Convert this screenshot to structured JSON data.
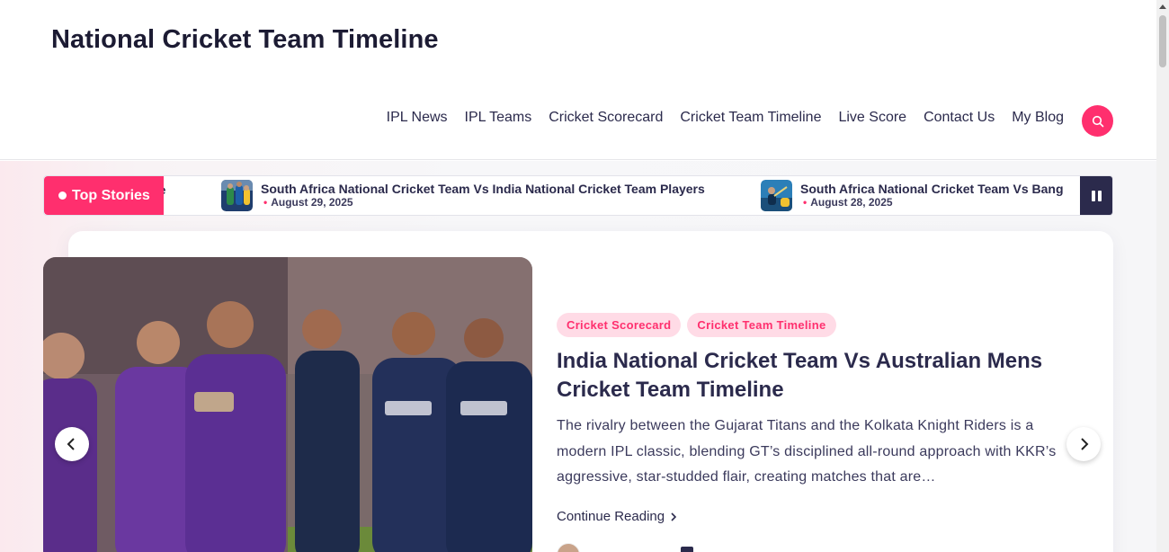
{
  "site": {
    "title": "National Cricket Team Timeline"
  },
  "nav": {
    "items": [
      {
        "label": "IPL News"
      },
      {
        "label": "IPL Teams"
      },
      {
        "label": "Cricket Scorecard"
      },
      {
        "label": "Cricket Team Timeline"
      },
      {
        "label": "Live Score"
      },
      {
        "label": "Contact Us"
      },
      {
        "label": "My Blog"
      }
    ],
    "search_icon": "search-icon"
  },
  "ticker": {
    "label": "Top Stories",
    "items": [
      {
        "title": "meline",
        "date": ""
      },
      {
        "title": "South Africa National Cricket Team Vs India National Cricket Team Players",
        "date": "August 29, 2025"
      },
      {
        "title": "South Africa National Cricket Team Vs Bang",
        "date": "August 28, 2025"
      }
    ]
  },
  "featured": {
    "tags": [
      "Cricket Scorecard",
      "Cricket Team Timeline"
    ],
    "title": "India National Cricket Team Vs Australian Mens Cricket Team Timeline",
    "excerpt": "The rivalry between the Gujarat Titans and the Kolkata Knight Riders is a modern IPL classic, blending GT’s disciplined all-round approach with KKR’s aggressive, star-studded flair, creating matches that are…",
    "read_more": "Continue Reading"
  },
  "colors": {
    "accent": "#ff2f6e",
    "navy": "#2b2a4c",
    "tag_bg": "#ffdbe6"
  }
}
